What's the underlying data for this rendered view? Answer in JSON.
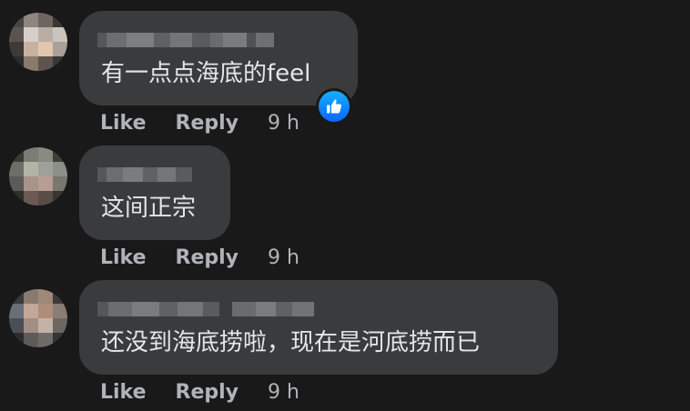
{
  "comments": [
    {
      "text": "有一点点海底的feel",
      "like_label": "Like",
      "reply_label": "Reply",
      "time": "9 h",
      "reaction_icon": "thumbs-up-icon"
    },
    {
      "text": "这间正宗",
      "like_label": "Like",
      "reply_label": "Reply",
      "time": "9 h"
    },
    {
      "text": "还没到海底捞啦，现在是河底捞而已",
      "like_label": "Like",
      "reply_label": "Reply",
      "time": "9 h"
    }
  ],
  "colors": {
    "background": "#19191a",
    "bubble": "#3a3b3c",
    "text": "#e4e6eb",
    "meta": "#b0b3b8",
    "reaction_blue": "#0866ff"
  }
}
